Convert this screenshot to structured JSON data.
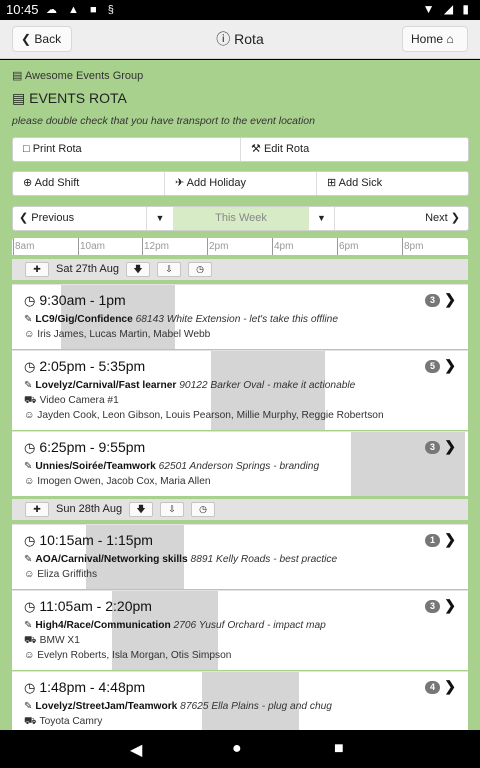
{
  "status": {
    "time": "10:45",
    "left_icons": "☁ ▲ ■ §",
    "right_icons": "▼ ◢ ▮"
  },
  "header": {
    "back_label": "Back",
    "title": "Rota",
    "home_label": "Home"
  },
  "org_name": "Awesome Events Group",
  "rota_title": "EVENTS ROTA",
  "notice": "please double check that you have transport to the event location",
  "actions": {
    "print": "Print Rota",
    "edit": "Edit Rota",
    "add_shift": "Add Shift",
    "add_holiday": "Add Holiday",
    "add_sick": "Add Sick"
  },
  "nav": {
    "previous": "Previous",
    "this_week": "This Week",
    "next": "Next"
  },
  "timeline": [
    "8am",
    "10am",
    "12pm",
    "2pm",
    "4pm",
    "6pm",
    "8pm"
  ],
  "days": [
    {
      "label": "Sat 27th Aug"
    },
    {
      "label": "Sun 28th Aug"
    }
  ],
  "shifts": [
    {
      "time": "9:30am - 1pm",
      "name": "LC9/Gig/Confidence",
      "detail": "68143 White Extension - let's take this offline",
      "vehicle": "",
      "staff": "Iris James, Lucas Martin, Mabel Webb",
      "count": "3"
    },
    {
      "time": "2:05pm - 5:35pm",
      "name": "Lovelyz/Carnival/Fast learner",
      "detail": "90122 Barker Oval - make it actionable",
      "vehicle": "Video Camera #1",
      "staff": "Jayden Cook, Leon Gibson, Louis Pearson, Millie Murphy, Reggie Robertson",
      "count": "5"
    },
    {
      "time": "6:25pm - 9:55pm",
      "name": "Unnies/Soirée/Teamwork",
      "detail": "62501 Anderson Springs - branding",
      "vehicle": "",
      "staff": "Imogen Owen, Jacob Cox, Maria Allen",
      "count": "3"
    },
    {
      "time": "10:15am - 1:15pm",
      "name": "AOA/Carnival/Networking skills",
      "detail": "8891 Kelly Roads - best practice",
      "vehicle": "",
      "staff": "Eliza Griffiths",
      "count": "1"
    },
    {
      "time": "11:05am - 2:20pm",
      "name": "High4/Race/Communication",
      "detail": "2706 Yusuf Orchard - impact map",
      "vehicle": "BMW X1",
      "staff": "Evelyn Roberts, Isla Morgan, Otis Simpson",
      "count": "3"
    },
    {
      "time": "1:48pm - 4:48pm",
      "name": "Lovelyz/StreetJam/Teamwork",
      "detail": "87625 Ella Plains - plug and chug",
      "vehicle": "Toyota Camry",
      "staff": "",
      "count": "4"
    }
  ],
  "icons": {
    "back": "chevron-left-icon",
    "home": "home-icon",
    "info": "info-icon",
    "clock": "clock-icon",
    "pen": "pen-icon",
    "truck": "truck-icon",
    "user": "user-icon",
    "plus": "plus-circle-icon",
    "down": "arrow-down-icon"
  },
  "colors": {
    "background": "#a9d18e",
    "header": "#eeeeee",
    "badge": "#777777",
    "timeline_shade": "#d5d5d5"
  }
}
